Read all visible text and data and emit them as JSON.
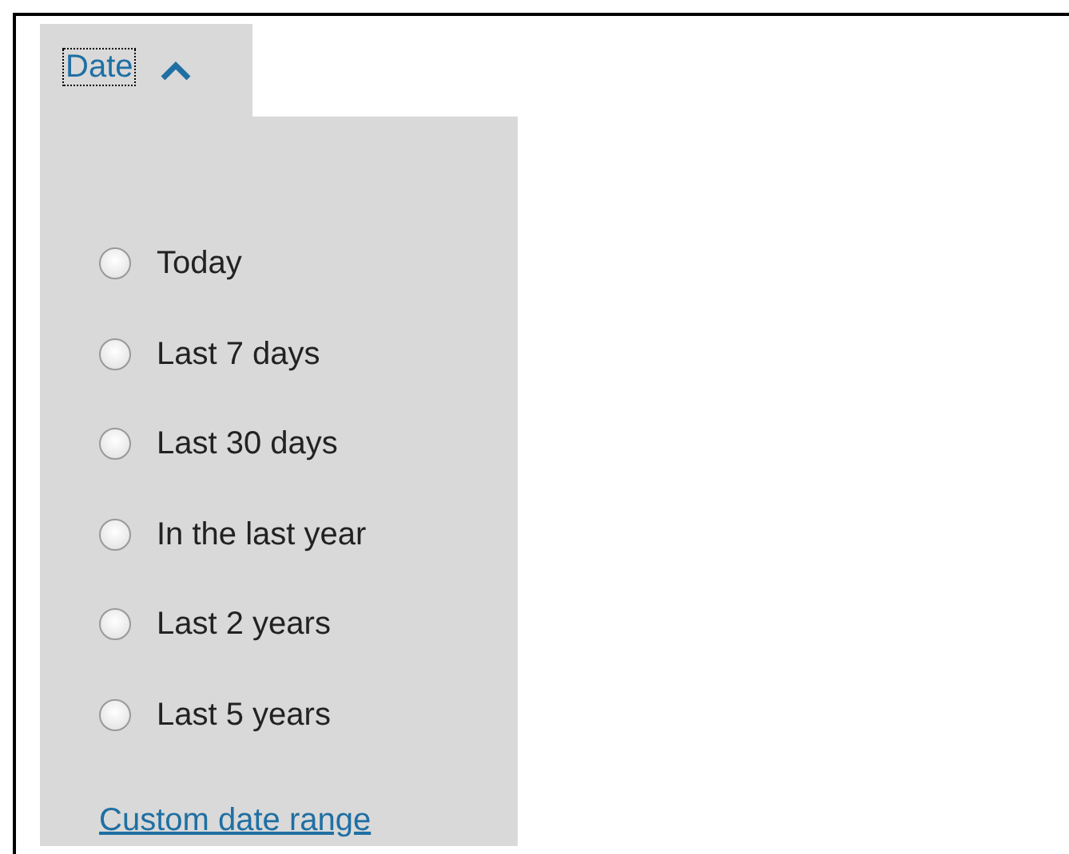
{
  "filter": {
    "title": "Date",
    "expanded": true,
    "options": [
      {
        "label": "Today",
        "selected": false
      },
      {
        "label": "Last 7 days",
        "selected": false
      },
      {
        "label": "Last 30 days",
        "selected": false
      },
      {
        "label": "In the last year",
        "selected": false
      },
      {
        "label": "Last 2 years",
        "selected": false
      },
      {
        "label": "Last 5 years",
        "selected": false
      }
    ],
    "link": "Custom date range"
  }
}
